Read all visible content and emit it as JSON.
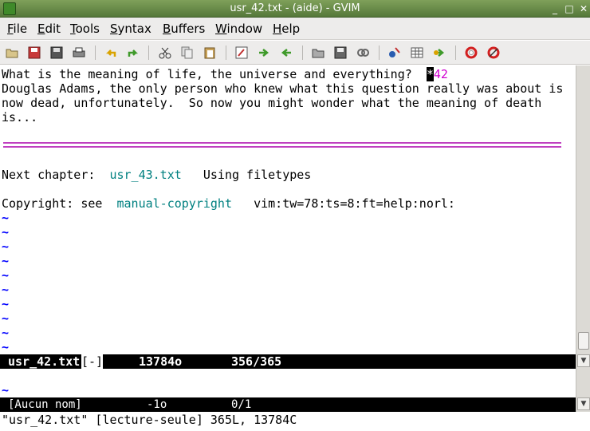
{
  "window": {
    "title": "usr_42.txt - (aide) - GVIM",
    "controls": {
      "minimize": "_",
      "maximize": "□",
      "close": "✕"
    }
  },
  "menubar": {
    "items": [
      {
        "label": "File",
        "mnemonic": "F",
        "rest": "ile"
      },
      {
        "label": "Edit",
        "mnemonic": "E",
        "rest": "dit"
      },
      {
        "label": "Tools",
        "mnemonic": "T",
        "rest": "ools"
      },
      {
        "label": "Syntax",
        "mnemonic": "S",
        "rest": "yntax"
      },
      {
        "label": "Buffers",
        "mnemonic": "B",
        "rest": "uffers"
      },
      {
        "label": "Window",
        "mnemonic": "W",
        "rest": "indow"
      },
      {
        "label": "Help",
        "mnemonic": "H",
        "rest": "elp"
      }
    ]
  },
  "toolbar": {
    "icons": [
      "open-icon",
      "save-icon",
      "save-all-icon",
      "print-icon",
      "undo-icon",
      "redo-icon",
      "cut-icon",
      "copy-icon",
      "paste-icon",
      "replace-icon",
      "find-next-icon",
      "find-prev-icon",
      "load-session-icon",
      "save-session-icon",
      "run-script-icon",
      "make-icon",
      "build-tags-icon",
      "jump-tag-icon",
      "help-icon",
      "find-help-icon"
    ],
    "colors": {
      "arrow_green": "#3f9a2a",
      "undo_yellow": "#d9a300",
      "lifebuoy_red": "#d22020"
    }
  },
  "editor": {
    "line1_text": "What is the meaning of life, the universe and everything?  ",
    "line1_cursor_char": "*",
    "line1_tag": "42",
    "line2": "Douglas Adams, the only person who knew what this question really was about is",
    "line3": "now dead, unfortunately.  So now you might wonder what the meaning of death",
    "line4": "is...",
    "next_chapter_label": "Next chapter:  ",
    "next_chapter_link": "usr_43.txt",
    "next_chapter_desc": "   Using filetypes",
    "copyright_label": "Copyright: see  ",
    "copyright_link": "manual-copyright",
    "modeline": "   vim:tw=78:ts=8:ft=help:norl:",
    "tilde": "~",
    "colors": {
      "link": "#008080",
      "tag": "#d000d0",
      "tilde": "#0000ff",
      "separator": "#c040c0"
    }
  },
  "status_active": {
    "filename": "usr_42.txt",
    "flag": "[-]",
    "size": "13784o",
    "position": "356/365"
  },
  "status_inactive": {
    "filename": "[Aucun nom]",
    "size": "-1o",
    "position": "0/1"
  },
  "cmdline": {
    "message": "\"usr_42.txt\" [lecture-seule] 365L, 13784C"
  },
  "scrollbar": {
    "up": "▲",
    "down": "▼"
  }
}
